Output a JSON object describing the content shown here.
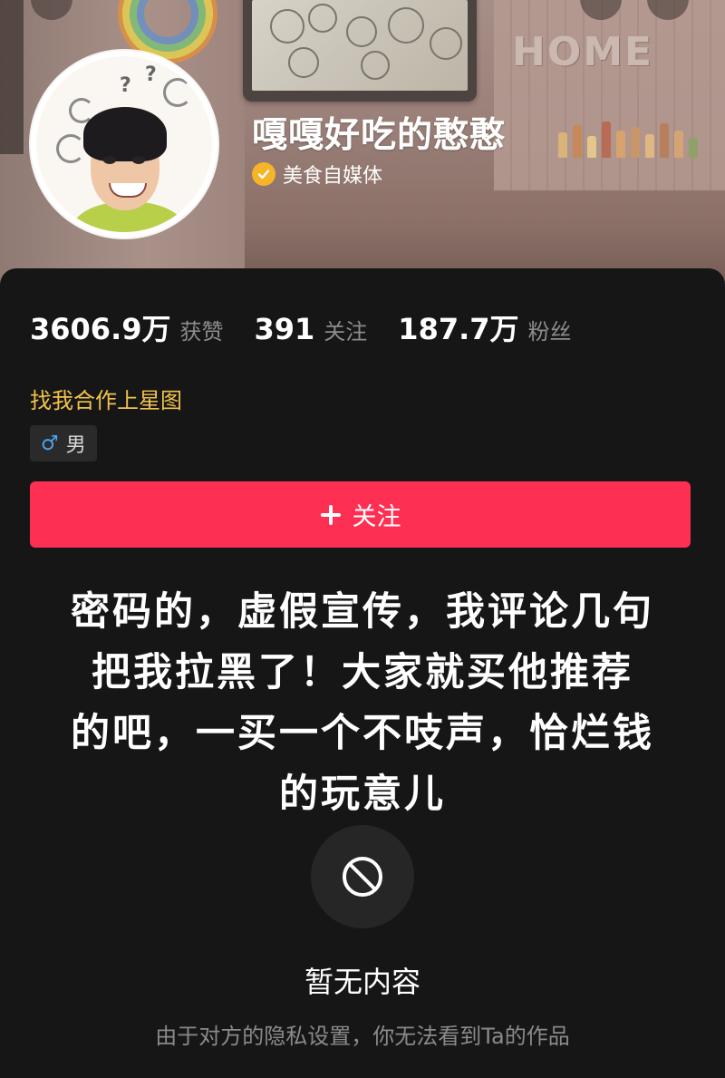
{
  "banner": {
    "sign_text": "HOME"
  },
  "profile": {
    "username": "嘎嘎好吃的憨憨",
    "verified_label": "美食自媒体"
  },
  "stats": [
    {
      "value": "3606.9万",
      "label": "获赞"
    },
    {
      "value": "391",
      "label": "关注"
    },
    {
      "value": "187.7万",
      "label": "粉丝"
    }
  ],
  "star_link": "找我合作上星图",
  "gender": {
    "symbol": "♂",
    "label": "男"
  },
  "follow_button": {
    "label": "关注"
  },
  "overlay_caption": {
    "lines": [
      "密码的，虚假宣传，我评论几句",
      "把我拉黑了！大家就买他推荐",
      "的吧，一买一个不吱声，恰烂钱",
      "的玩意儿"
    ]
  },
  "empty_state": {
    "title": "暂无内容",
    "description": "由于对方的隐私设置，你无法看到Ta的作品"
  },
  "colors": {
    "accent_red": "#fd3053",
    "gold": "#f3c24a",
    "verify_badge": "#f6b428",
    "male_blue": "#4aa3ee",
    "background": "#161616"
  },
  "icons": [
    "verified-check-icon",
    "plus-icon",
    "male-icon",
    "blocked-icon"
  ]
}
